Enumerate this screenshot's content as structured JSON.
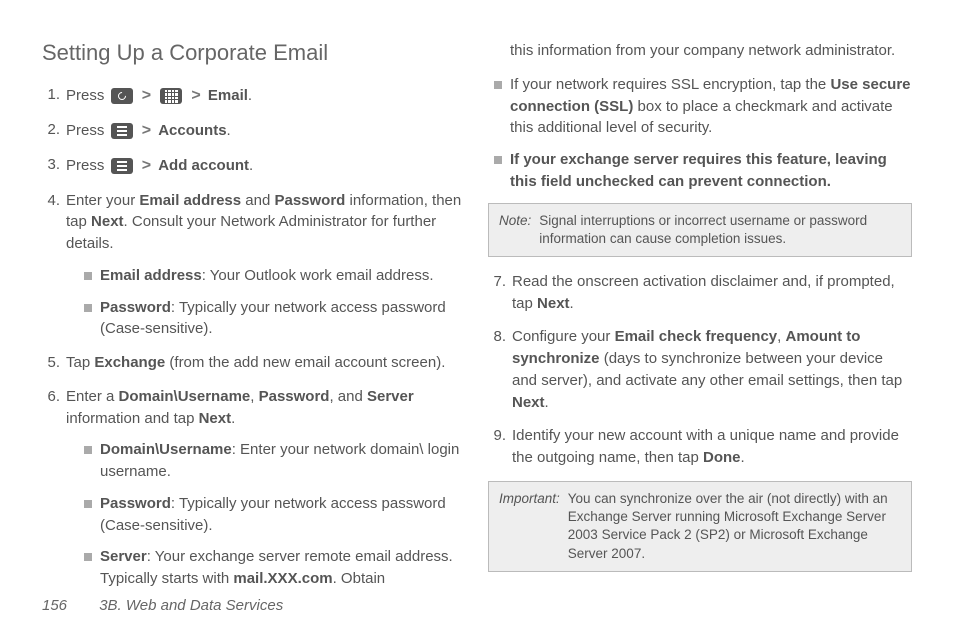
{
  "heading": "Setting Up a Corporate Email",
  "email_label": "Email",
  "accounts_label": "Accounts",
  "addaccount_label": "Add account",
  "press": "Press",
  "step4": {
    "a": "Enter your ",
    "b": "Email address",
    "c": " and ",
    "d": "Password",
    "e": " information, then tap ",
    "f": "Next",
    "g": ". Consult your Network Administrator for further details."
  },
  "s4sub1": {
    "b": "Email address",
    "t": ": Your Outlook work email address."
  },
  "s4sub2": {
    "b": "Password",
    "t": ": Typically your network access password (Case-sensitive)."
  },
  "step5": {
    "a": "Tap ",
    "b": "Exchange",
    "c": " (from the add new email account screen)."
  },
  "step6": {
    "a": "Enter a ",
    "b": "Domain\\Username",
    "c": ", ",
    "d": "Password",
    "e": ", and ",
    "f": "Server",
    "g": " information and tap ",
    "h": "Next",
    "i": "."
  },
  "s6sub1": {
    "b": "Domain\\Username",
    "t": ": Enter your network domain\\ login username."
  },
  "s6sub2": {
    "b": "Password",
    "t": ": Typically your network access password (Case-sensitive)."
  },
  "s6sub3": {
    "b": "Server",
    "t1": ": Your exchange server remote email address. Typically starts with ",
    "b2": "mail.XXX.com",
    "t2": ". Obtain"
  },
  "col2top": "this information from your company network administrator.",
  "ssl": {
    "a": "If your network requires SSL encryption, tap the ",
    "b": "Use secure connection (SSL)",
    "c": " box to place a checkmark and activate this additional level of security."
  },
  "sslwarn": "If your exchange server requires this feature, leaving this field unchecked can prevent connection",
  "note1": {
    "label": "Note:",
    "txt": "Signal interruptions or incorrect username or password information can cause completion issues."
  },
  "step7": {
    "a": "Read the onscreen activation disclaimer and, if prompted, tap ",
    "b": "Next",
    "c": "."
  },
  "step8": {
    "a": "Configure your ",
    "b": "Email check frequency",
    "c": ", ",
    "d": "Amount to synchronize",
    "e": " (days to synchronize between your device and server), and activate any other email settings, then tap ",
    "f": "Next",
    "g": "."
  },
  "step9": {
    "a": "Identify your new account with a unique name and provide the outgoing name, then tap ",
    "b": "Done",
    "c": "."
  },
  "note2": {
    "label": "Important:",
    "txt": "You can synchronize over the air (not directly) with an Exchange Server running Microsoft Exchange Server 2003 Service Pack 2 (SP2) or Microsoft Exchange Server 2007."
  },
  "footer": {
    "page": "156",
    "section": "3B. Web and Data Services"
  }
}
